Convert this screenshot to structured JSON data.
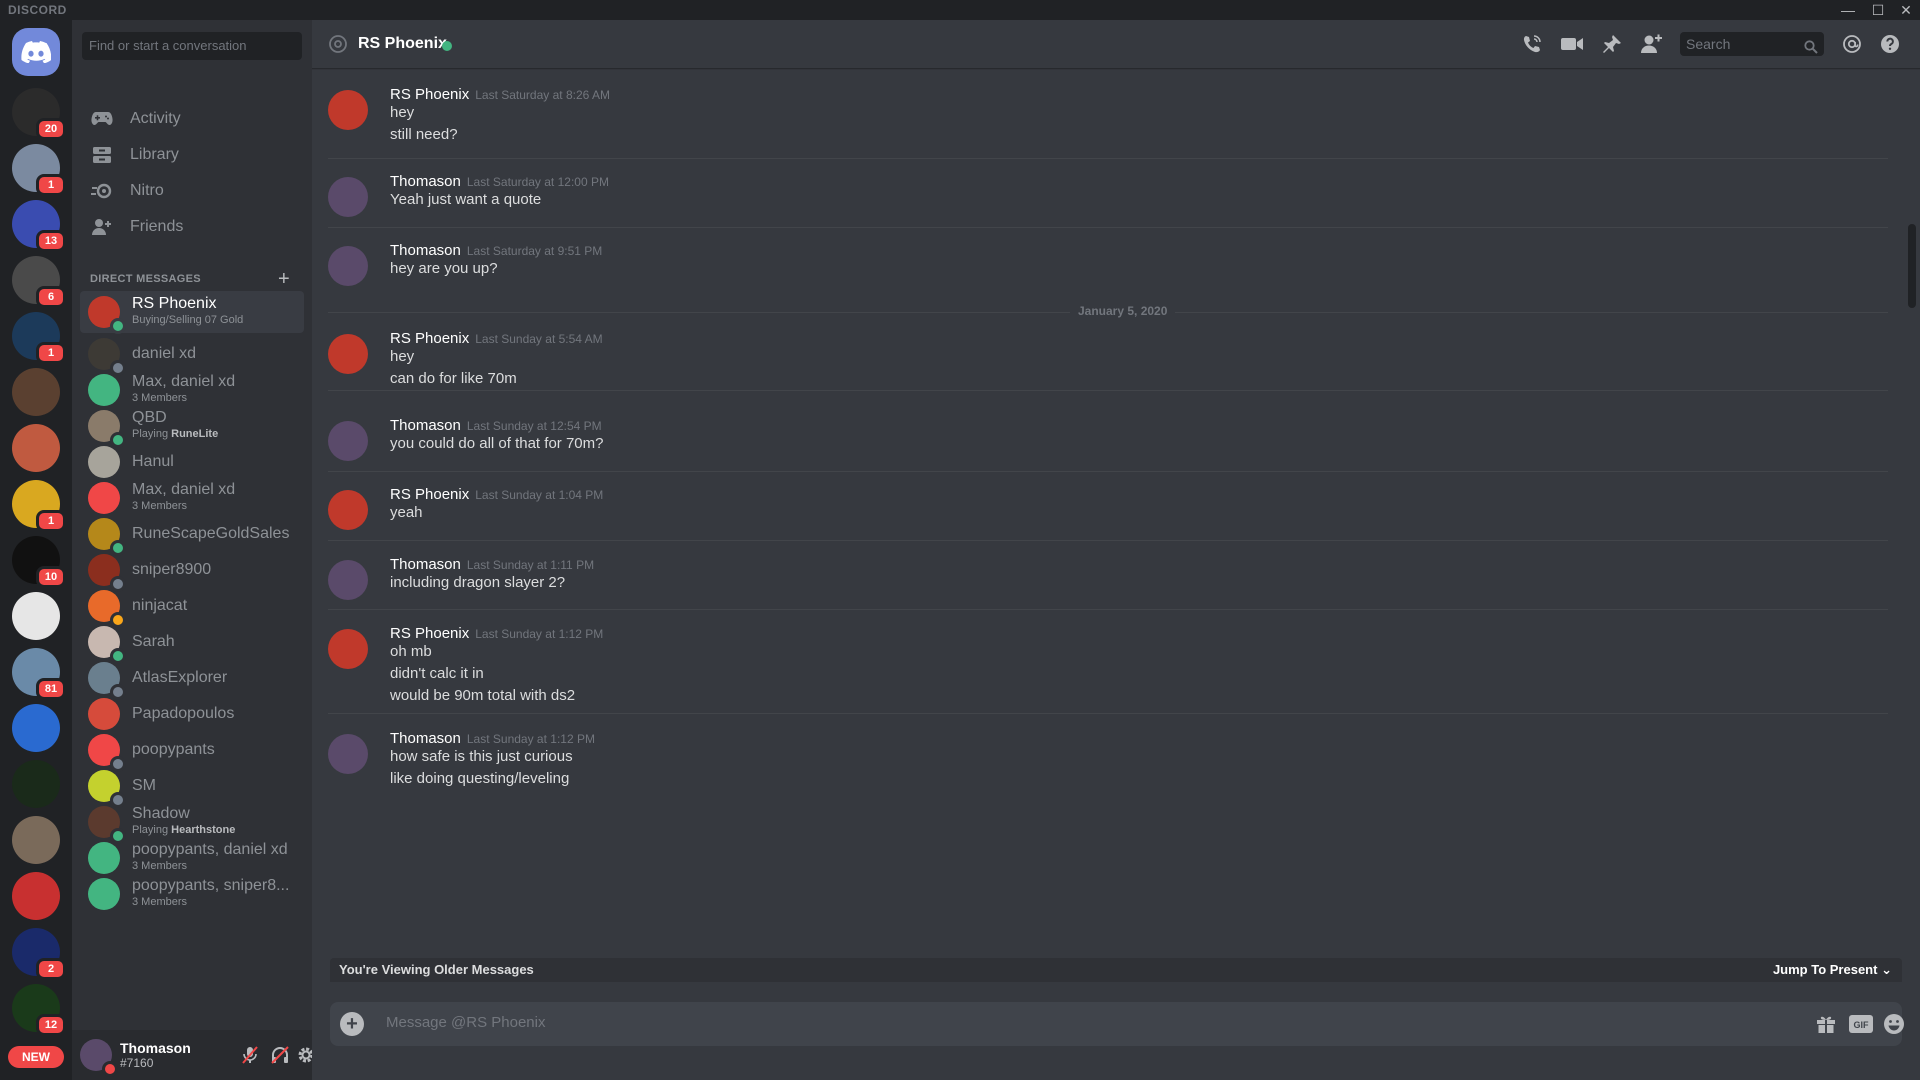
{
  "window": {
    "brand": "DISCORD",
    "controls": [
      "—",
      "☐",
      "✕"
    ]
  },
  "guilds": {
    "new_label": "NEW",
    "badges": [
      "20",
      "1",
      "13",
      "6",
      "1",
      "1",
      "10",
      "81",
      "2",
      "12"
    ]
  },
  "dm_sidebar": {
    "search_placeholder": "Find or start a conversation",
    "nav": [
      {
        "label": "Activity",
        "icon": "gamepad-icon"
      },
      {
        "label": "Library",
        "icon": "library-icon"
      },
      {
        "label": "Nitro",
        "icon": "nitro-icon"
      },
      {
        "label": "Friends",
        "icon": "friends-icon"
      }
    ],
    "header": "DIRECT MESSAGES",
    "add": "+",
    "dms": [
      {
        "name": "RS Phoenix",
        "sub": "Buying/Selling 07 Gold",
        "avatar_color": "#c0392b",
        "status_color": "#43b581",
        "active": true
      },
      {
        "name": "daniel xd",
        "sub": "",
        "avatar_color": "#3d3a35",
        "status_color": "#747f8d"
      },
      {
        "name": "Max, daniel xd",
        "sub": "3 Members",
        "avatar_color": "#43b581",
        "status_color": ""
      },
      {
        "name": "QBD",
        "sub_prefix": "Playing ",
        "sub_bold": "RuneLite",
        "avatar_color": "#8a7b6a",
        "status_color": "#43b581"
      },
      {
        "name": "Hanul",
        "sub": "",
        "avatar_color": "#a7a49b",
        "status_color": ""
      },
      {
        "name": "Max, daniel xd",
        "sub": "3 Members",
        "avatar_color": "#f04747",
        "status_color": ""
      },
      {
        "name": "RuneScapeGoldSales",
        "sub": "",
        "avatar_color": "#b5881a",
        "status_color": "#43b581"
      },
      {
        "name": "sniper8900",
        "sub": "",
        "avatar_color": "#8b2e1e",
        "status_color": "#747f8d"
      },
      {
        "name": "ninjacat",
        "sub": "",
        "avatar_color": "#e86a2a",
        "status_color": "#faa61a"
      },
      {
        "name": "Sarah",
        "sub": "",
        "avatar_color": "#c8b8b0",
        "status_color": "#43b581"
      },
      {
        "name": "AtlasExplorer",
        "sub": "",
        "avatar_color": "#6a7f8e",
        "status_color": "#747f8d"
      },
      {
        "name": "Papadopoulos",
        "sub": "",
        "avatar_color": "#d64b3b",
        "status_color": ""
      },
      {
        "name": "poopypants",
        "sub": "",
        "avatar_color": "#f04747",
        "status_color": "#747f8d"
      },
      {
        "name": "SM",
        "sub": "",
        "avatar_color": "#c4d12e",
        "status_color": "#747f8d"
      },
      {
        "name": "Shadow",
        "sub_prefix": "Playing ",
        "sub_bold": "Hearthstone",
        "avatar_color": "#5b3a2e",
        "status_color": "#43b581"
      },
      {
        "name": "poopypants, daniel xd",
        "sub": "3 Members",
        "avatar_color": "#43b581",
        "status_color": ""
      },
      {
        "name": "poopypants, sniper8...",
        "sub": "3 Members",
        "avatar_color": "#43b581",
        "status_color": ""
      }
    ]
  },
  "user_panel": {
    "name": "Thomason",
    "tag": "#7160"
  },
  "chat": {
    "title": "RS Phoenix",
    "search_placeholder": "Search",
    "date_divider": "January 5, 2020",
    "messages": [
      {
        "author": "RS Phoenix",
        "time": "Last Saturday at 8:26 AM",
        "lines": [
          "hey",
          "still need?"
        ],
        "avatar_color": "#c0392b"
      },
      {
        "author": "Thomason",
        "time": "Last Saturday at 12:00 PM",
        "lines": [
          "Yeah just want a quote"
        ],
        "avatar_color": "#5a4a6a"
      },
      {
        "author": "Thomason",
        "time": "Last Saturday at 9:51 PM",
        "lines": [
          "hey are you up?"
        ],
        "avatar_color": "#5a4a6a"
      },
      {
        "author": "RS Phoenix",
        "time": "Last Sunday at 5:54 AM",
        "lines": [
          "hey",
          "can do for like 70m"
        ],
        "avatar_color": "#c0392b"
      },
      {
        "author": "Thomason",
        "time": "Last Sunday at 12:54 PM",
        "lines": [
          "you could do all of that for 70m?"
        ],
        "avatar_color": "#5a4a6a"
      },
      {
        "author": "RS Phoenix",
        "time": "Last Sunday at 1:04 PM",
        "lines": [
          "yeah"
        ],
        "avatar_color": "#c0392b"
      },
      {
        "author": "Thomason",
        "time": "Last Sunday at 1:11 PM",
        "lines": [
          "including dragon slayer 2?"
        ],
        "avatar_color": "#5a4a6a"
      },
      {
        "author": "RS Phoenix",
        "time": "Last Sunday at 1:12 PM",
        "lines": [
          "oh mb",
          "didn't calc it in",
          "would be 90m total with ds2"
        ],
        "avatar_color": "#c0392b"
      },
      {
        "author": "Thomason",
        "time": "Last Sunday at 1:12 PM",
        "lines": [
          "how safe is this just curious",
          "like doing questing/leveling"
        ],
        "avatar_color": "#5a4a6a"
      }
    ],
    "older_notice": "You're Viewing Older Messages",
    "jump_label": "Jump To Present",
    "composer_placeholder": "Message @RS Phoenix"
  }
}
